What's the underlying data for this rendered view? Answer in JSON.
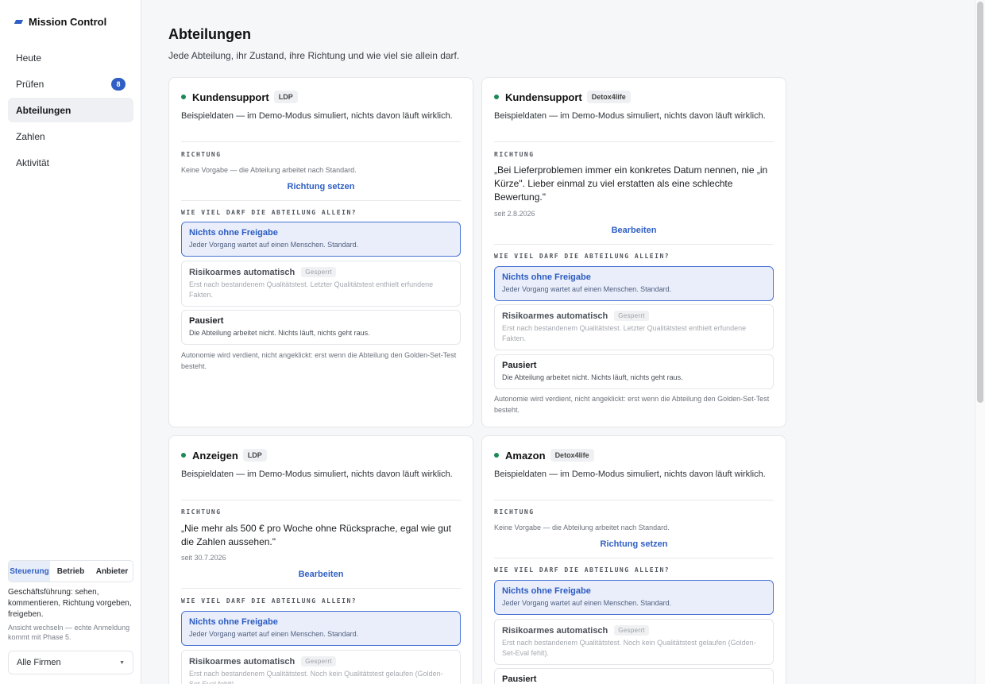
{
  "brand": {
    "name": "Mission Control"
  },
  "nav": [
    {
      "label": "Heute",
      "badge": ""
    },
    {
      "label": "Prüfen",
      "badge": "8"
    },
    {
      "label": "Abteilungen",
      "badge": ""
    },
    {
      "label": "Zahlen",
      "badge": ""
    },
    {
      "label": "Aktivität",
      "badge": ""
    }
  ],
  "roles": {
    "r1": "Steuerung",
    "r2": "Betrieb",
    "r3": "Anbieter",
    "description": "Geschäftsführung: sehen, kommentieren, Richtung vorgeben, freigeben.",
    "note": "Ansicht wechseln — echte Anmeldung kommt mit Phase 5."
  },
  "company_select": {
    "value": "Alle Firmen"
  },
  "page": {
    "title": "Abteilungen",
    "subtitle": "Jede Abteilung, ihr Zustand, ihre Richtung und wie viel sie allein darf."
  },
  "labels": {
    "richtung": "RICHTUNG",
    "autonomy": "WIE VIEL DARF DIE ABTEILUNG ALLEIN?",
    "no_direction": "Keine Vorgabe — die Abteilung arbeitet nach Standard.",
    "set_direction": "Richtung setzen",
    "edit": "Bearbeiten",
    "opt1_title": "Nichts ohne Freigabe",
    "opt1_desc": "Jeder Vorgang wartet auf einen Menschen. Standard.",
    "opt2_title": "Risikoarmes automatisch",
    "locked": "Gesperrt",
    "opt3_title": "Pausiert",
    "opt3_desc": "Die Abteilung arbeitet nicht. Nichts läuft, nichts geht raus.",
    "footnote": "Autonomie wird verdient, nicht angeklickt: erst wenn die Abteilung den Golden-Set-Test besteht."
  },
  "cards": [
    {
      "name": "Kundensupport",
      "tag": "LDP",
      "desc": "Beispieldaten — im Demo-Modus simuliert, nichts davon läuft wirklich.",
      "opt2_desc": "Erst nach bestandenem Qualitätstest. Letzter Qualitätstest enthielt erfundene Fakten."
    },
    {
      "name": "Kundensupport",
      "tag": "Detox4life",
      "desc": "Beispieldaten — im Demo-Modus simuliert, nichts davon läuft wirklich.",
      "direction": "„Bei Lieferproblemen immer ein konkretes Datum nennen, nie „in Kürze\". Lieber einmal zu viel erstatten als eine schlechte Bewertung.\"",
      "since": "seit 2.8.2026",
      "opt2_desc": "Erst nach bestandenem Qualitätstest. Letzter Qualitätstest enthielt erfundene Fakten."
    },
    {
      "name": "Anzeigen",
      "tag": "LDP",
      "desc": "Beispieldaten — im Demo-Modus simuliert, nichts davon läuft wirklich.",
      "direction": "„Nie mehr als 500 € pro Woche ohne Rücksprache, egal wie gut die Zahlen aussehen.\"",
      "since": "seit 30.7.2026",
      "opt2_desc": "Erst nach bestandenem Qualitätstest. Noch kein Qualitätstest gelaufen (Golden-Set-Eval fehlt)."
    },
    {
      "name": "Amazon",
      "tag": "Detox4life",
      "desc": "Beispieldaten — im Demo-Modus simuliert, nichts davon läuft wirklich.",
      "opt2_desc": "Erst nach bestandenem Qualitätstest. Noch kein Qualitätstest gelaufen (Golden-Set-Eval fehlt)."
    }
  ]
}
